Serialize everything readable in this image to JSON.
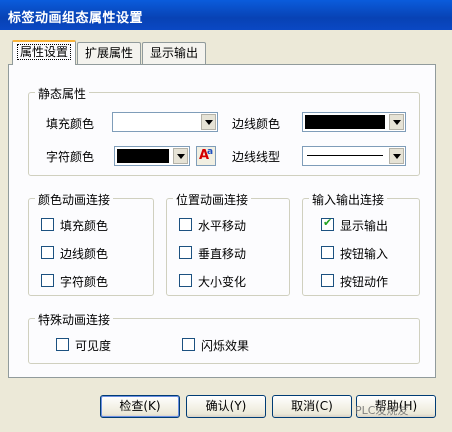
{
  "window": {
    "title": "标签动画组态属性设置"
  },
  "tabs": [
    {
      "label": "属性设置"
    },
    {
      "label": "扩展属性"
    },
    {
      "label": "显示输出"
    }
  ],
  "static_group": {
    "title": "静态属性",
    "fill_color_label": "填充颜色",
    "border_color_label": "边线颜色",
    "font_color_label": "字符颜色",
    "border_style_label": "边线线型"
  },
  "color_anim_group": {
    "title": "颜色动画连接",
    "items": [
      {
        "label": "填充颜色",
        "checked": false
      },
      {
        "label": "边线颜色",
        "checked": false
      },
      {
        "label": "字符颜色",
        "checked": false
      }
    ]
  },
  "position_anim_group": {
    "title": "位置动画连接",
    "items": [
      {
        "label": "水平移动",
        "checked": false
      },
      {
        "label": "垂直移动",
        "checked": false
      },
      {
        "label": "大小变化",
        "checked": false
      }
    ]
  },
  "io_group": {
    "title": "输入输出连接",
    "items": [
      {
        "label": "显示输出",
        "checked": true
      },
      {
        "label": "按钮输入",
        "checked": false
      },
      {
        "label": "按钮动作",
        "checked": false
      }
    ]
  },
  "special_group": {
    "title": "特殊动画连接",
    "items": [
      {
        "label": "可见度",
        "checked": false
      },
      {
        "label": "闪烁效果",
        "checked": false
      }
    ]
  },
  "buttons": {
    "check": "检查(K)",
    "ok": "确认(Y)",
    "cancel": "取消(C)",
    "help": "帮助(H)"
  },
  "watermark": "PLC发烧友",
  "colors": {
    "title_bar": "#0842b4",
    "dialog_bg": "#ece9d8",
    "border_color_swatch": "#000000",
    "font_color_swatch": "#000000"
  }
}
